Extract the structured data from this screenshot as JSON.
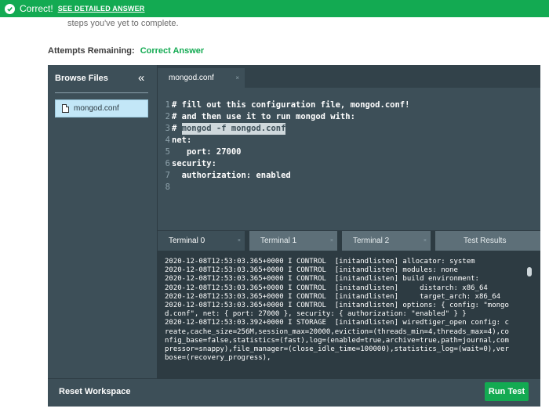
{
  "banner": {
    "status": "Correct!",
    "link": "SEE DETAILED ANSWER",
    "color": "#13aa52"
  },
  "intro": {
    "steps_text": "steps you've yet to complete."
  },
  "attempts": {
    "label": "Attempts Remaining:",
    "value": "Correct Answer"
  },
  "sidebar": {
    "title": "Browse Files",
    "collapse_glyph": "«",
    "files": [
      {
        "name": "mongod.conf",
        "icon": "file-icon"
      }
    ]
  },
  "editor": {
    "tab": {
      "label": "mongod.conf",
      "close": "×"
    },
    "lines": [
      {
        "n": "1",
        "text": "# fill out this configuration file, mongod.conf!"
      },
      {
        "n": "2",
        "text": "# and then use it to run mongod with:"
      },
      {
        "n": "3",
        "prefix": "# ",
        "highlight": "mongod -f mongod.conf"
      },
      {
        "n": "4",
        "text": "net:"
      },
      {
        "n": "5",
        "text": "   port: 27000"
      },
      {
        "n": "6",
        "text": "security:"
      },
      {
        "n": "7",
        "text": "  authorization: enabled"
      },
      {
        "n": "8",
        "text": ""
      }
    ]
  },
  "terminal": {
    "tabs": [
      {
        "label": "Terminal 0",
        "close": "×"
      },
      {
        "label": "Terminal 1",
        "close": "×"
      },
      {
        "label": "Terminal 2",
        "close": "×"
      },
      {
        "label": "Test Results",
        "close": ""
      }
    ],
    "output": [
      "2020-12-08T12:53:03.365+0000 I CONTROL  [initandlisten] allocator: system",
      "2020-12-08T12:53:03.365+0000 I CONTROL  [initandlisten] modules: none",
      "2020-12-08T12:53:03.365+0000 I CONTROL  [initandlisten] build environment:",
      "2020-12-08T12:53:03.365+0000 I CONTROL  [initandlisten]     distarch: x86_64",
      "2020-12-08T12:53:03.365+0000 I CONTROL  [initandlisten]     target_arch: x86_64",
      "2020-12-08T12:53:03.365+0000 I CONTROL  [initandlisten] options: { config: \"mongo",
      "d.conf\", net: { port: 27000 }, security: { authorization: \"enabled\" } }",
      "2020-12-08T12:53:03.392+0000 I STORAGE  [initandlisten] wiredtiger_open config: c",
      "reate,cache_size=256M,session_max=20000,eviction=(threads_min=4,threads_max=4),co",
      "nfig_base=false,statistics=(fast),log=(enabled=true,archive=true,path=journal,com",
      "pressor=snappy),file_manager=(close_idle_time=100000),statistics_log=(wait=0),ver",
      "bose=(recovery_progress),"
    ]
  },
  "footer": {
    "reset_label": "Reset Workspace",
    "run_label": "Run Test"
  }
}
